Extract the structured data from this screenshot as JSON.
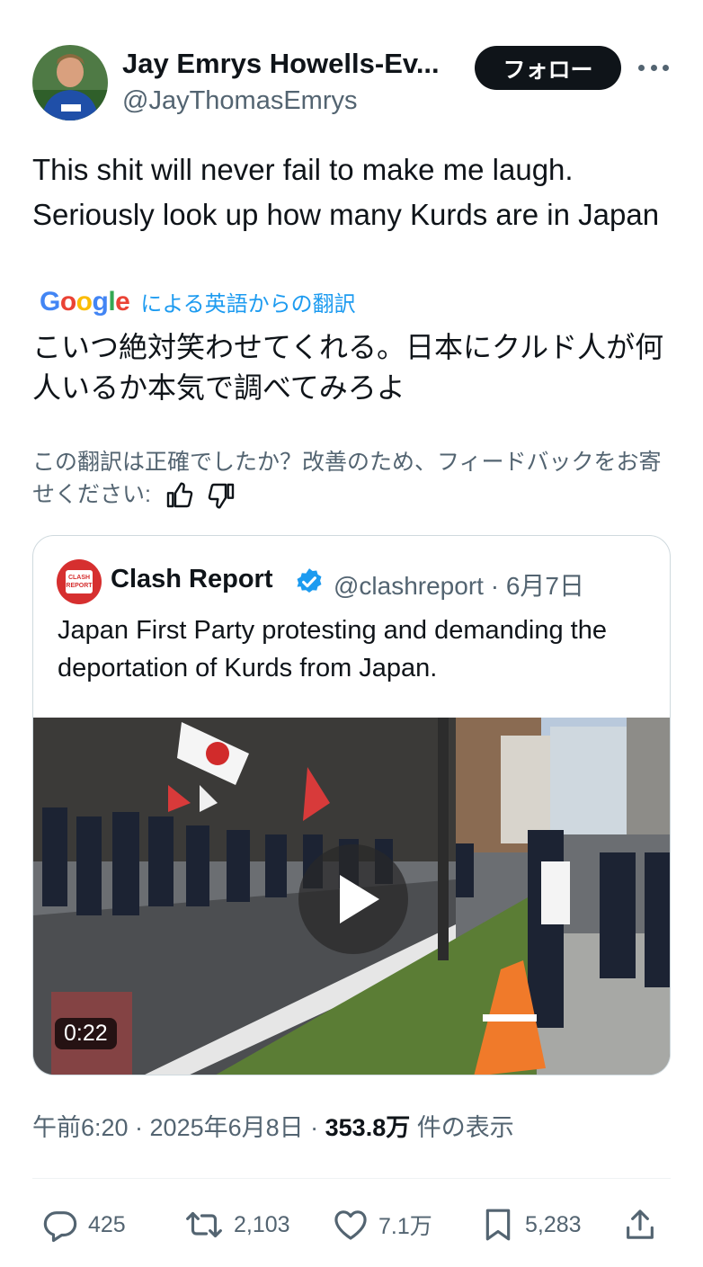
{
  "author": {
    "name": "Jay Emrys Howells-Ev...",
    "handle": "@JayThomasEmrys",
    "follow_label": "フォロー"
  },
  "tweet": {
    "text": "This shit will never fail to make me laugh. Seriously look up how many Kurds are in Japan",
    "translation_source": "Google",
    "translation_note": "による英語からの翻訳",
    "translation": "こいつ絶対笑わせてくれる。日本にクルド人が何人いるか本気で調べてみろよ",
    "feedback_prompt": "この翻訳は正確でしたか？改善のため、フィードバックをお寄せください:"
  },
  "quoted": {
    "name": "Clash Report",
    "handle": "@clashreport",
    "date": "6月7日",
    "separator": "·",
    "avatar_text": "CLASH REPORT",
    "text": "Japan First Party protesting and demanding the deportation of Kurds from Japan.",
    "video_duration": "0:22"
  },
  "meta": {
    "time": "午前6:20 · 2025年6月8日 · ",
    "views": "353.8万",
    "views_label": " 件の表示"
  },
  "actions": {
    "replies": "425",
    "retweets": "2,103",
    "likes": "7.1万",
    "bookmarks": "5,283"
  },
  "colors": {
    "accent": "#1d9bf0",
    "text": "#0f1419",
    "muted": "#536471",
    "border": "#cfd9de"
  },
  "icons": [
    "more-icon",
    "thumbs-up-icon",
    "thumbs-down-icon",
    "verified-badge-icon",
    "play-icon",
    "reply-icon",
    "retweet-icon",
    "like-icon",
    "bookmark-icon",
    "share-icon"
  ]
}
